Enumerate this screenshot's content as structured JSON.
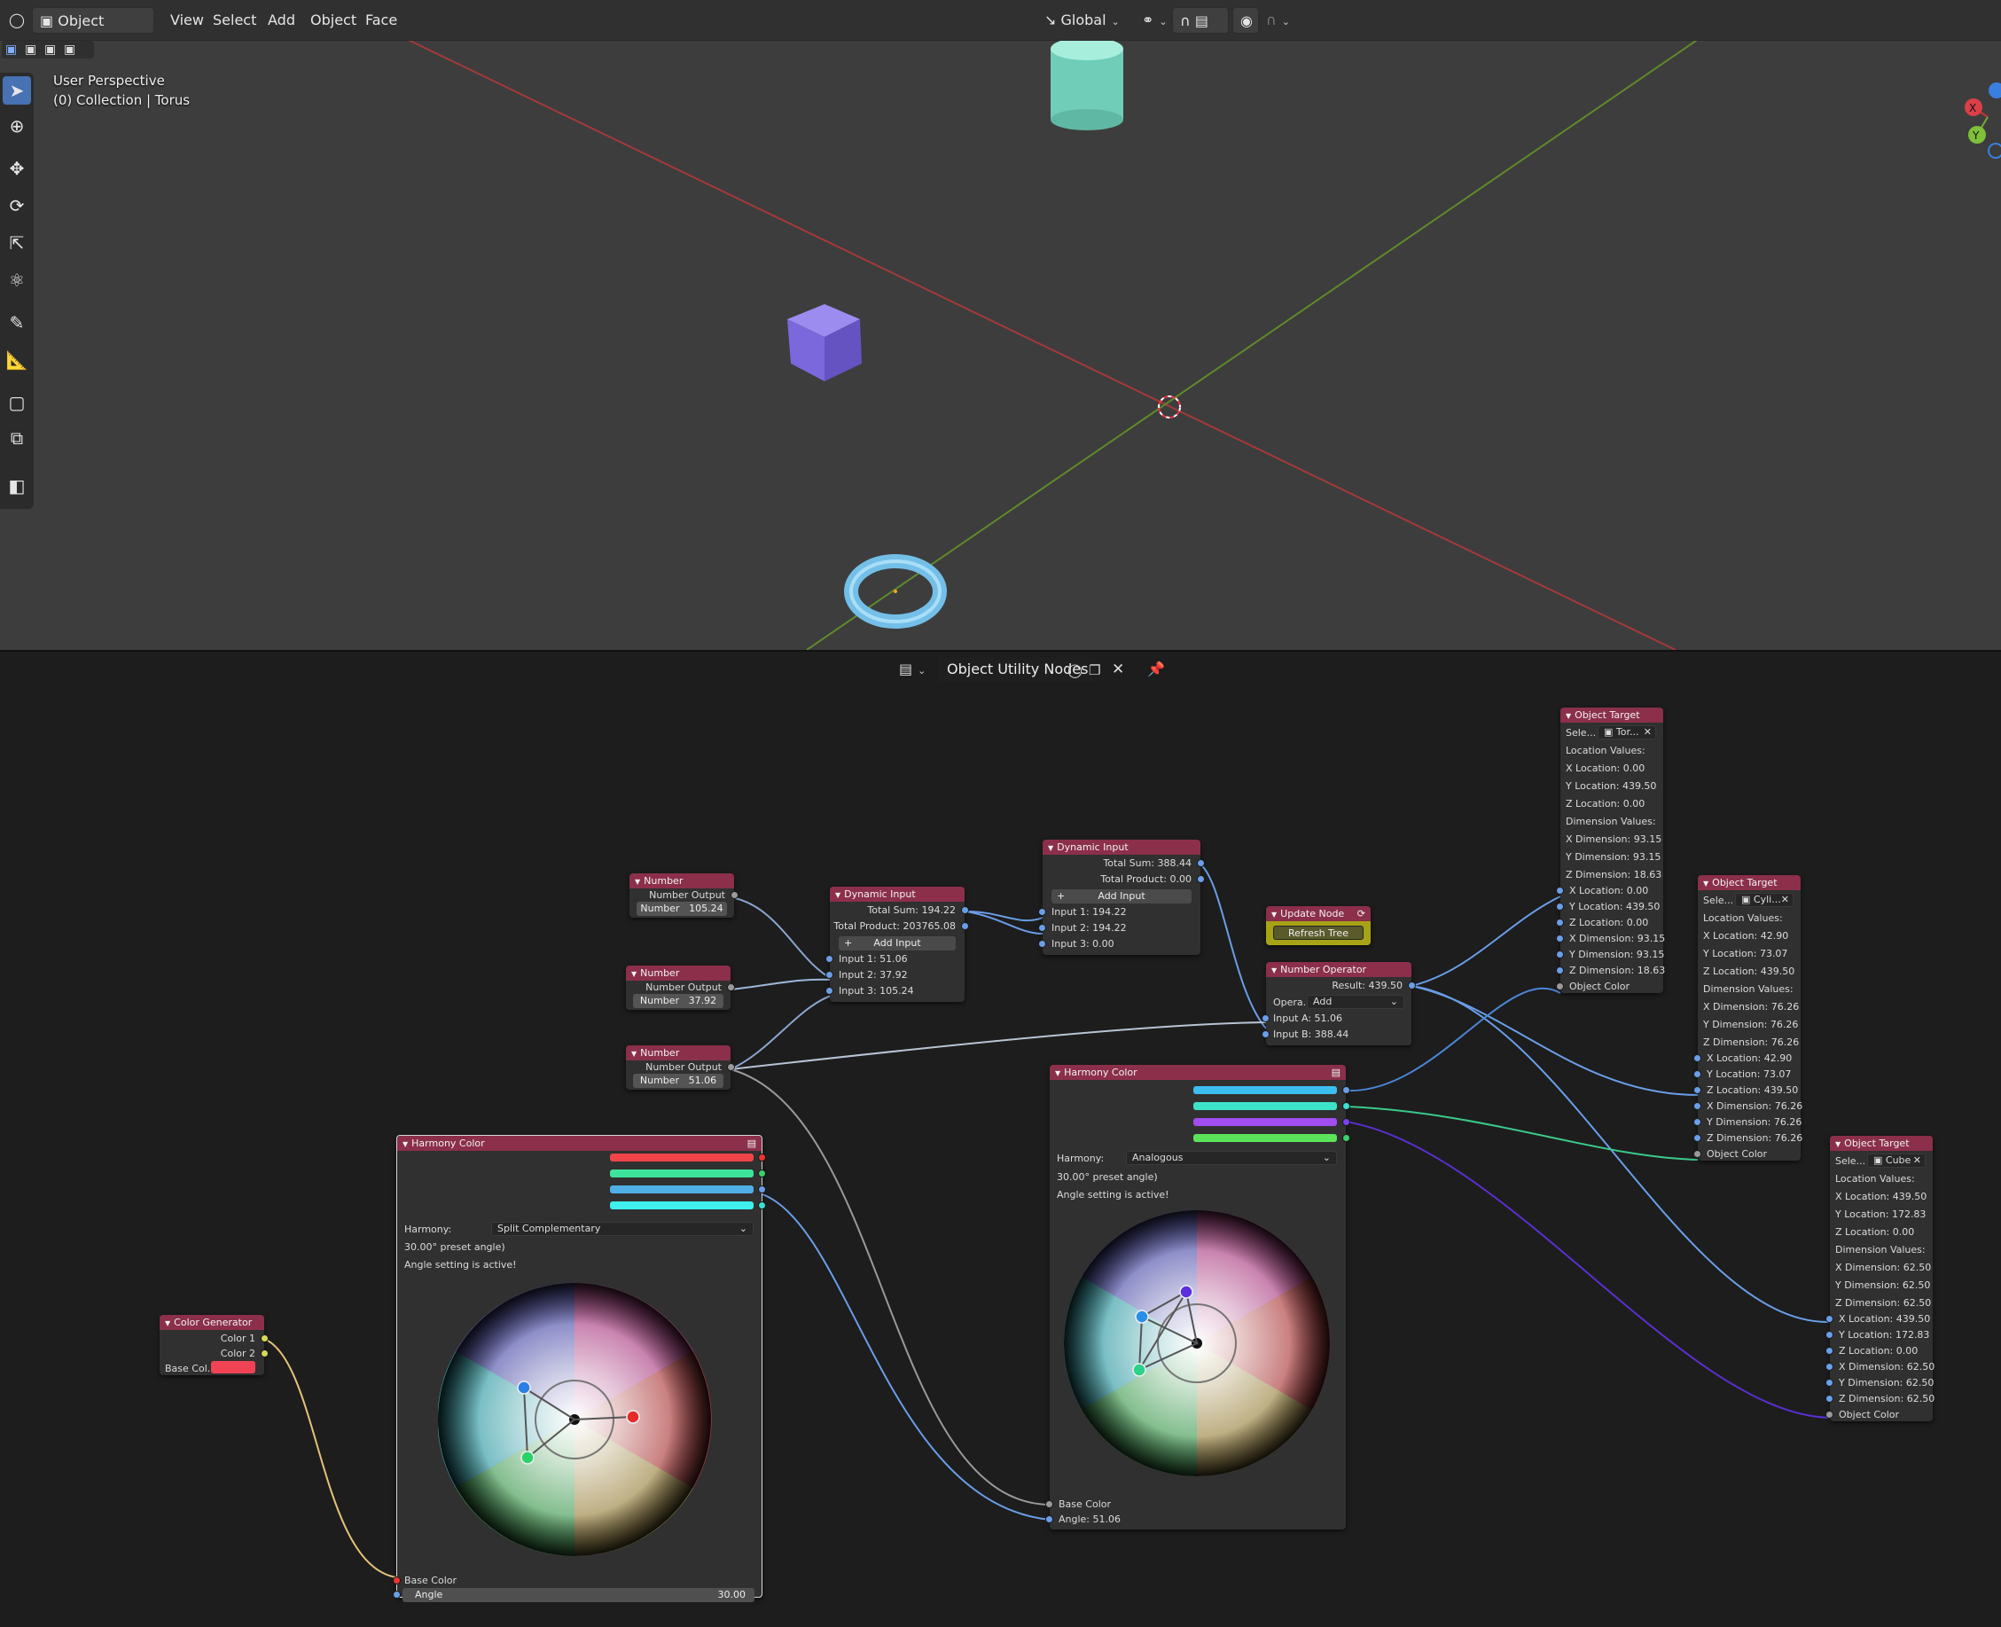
{
  "header": {
    "mode": "Object Mode",
    "menu": [
      "View",
      "Select",
      "Add",
      "Object",
      "Face"
    ],
    "orientation": "Global"
  },
  "viewport": {
    "perspective": "User Perspective",
    "collection": "(0) Collection | Torus",
    "colors": {
      "x_axis": "#a33a3a",
      "y_axis": "#5f8a2a",
      "cube": "#7a66d6",
      "cylinder": "#7fd6c4",
      "torus": "#6ab7e6"
    }
  },
  "node_editor": {
    "tree_name": "Object Utility Nodes"
  },
  "nodes": {
    "number1": {
      "title": "Number",
      "output": "Number Output",
      "label": "Number",
      "value": "105.24"
    },
    "number2": {
      "title": "Number",
      "output": "Number Output",
      "label": "Number",
      "value": "37.92"
    },
    "number3": {
      "title": "Number",
      "output": "Number Output",
      "label": "Number",
      "value": "51.06"
    },
    "dyn1": {
      "title": "Dynamic Input",
      "sum": "Total Sum: 194.22",
      "product": "Total Product: 203765.08",
      "add": "Add Input",
      "in1": "Input 1: 51.06",
      "in2": "Input 2: 37.92",
      "in3": "Input 3: 105.24"
    },
    "dyn2": {
      "title": "Dynamic Input",
      "sum": "Total Sum: 388.44",
      "product": "Total Product: 0.00",
      "add": "Add Input",
      "in1": "Input 1: 194.22",
      "in2": "Input 2: 194.22",
      "in3": "Input 3: 0.00"
    },
    "update": {
      "title": "Update Node",
      "button": "Refresh Tree"
    },
    "numop": {
      "title": "Number Operator",
      "result": "Result: 439.50",
      "op_label": "Opera...",
      "op_value": "Add",
      "a": "Input A: 51.06",
      "b": "Input B: 388.44"
    },
    "colorgen": {
      "title": "Color Generator",
      "c1": "Color 1",
      "c2": "Color 2",
      "base": "Base Col...",
      "base_color": "#f04455"
    },
    "harmony1": {
      "title": "Harmony Color",
      "harmony_label": "Harmony:",
      "harmony_value": "Split Complementary",
      "preset": "30.00° preset angle)",
      "active": "Angle setting is active!",
      "base": "Base Color",
      "angle_label": "Angle",
      "angle_value": "30.00",
      "swatches": [
        "#f04448",
        "#3de39a",
        "#4fb0e8",
        "#3ef0ee"
      ]
    },
    "harmony2": {
      "title": "Harmony Color",
      "harmony_label": "Harmony:",
      "harmony_value": "Analogous",
      "preset": "30.00° preset angle)",
      "active": "Angle setting is active!",
      "base": "Base Color",
      "angle": "Angle: 51.06",
      "swatches": [
        "#3dbef0",
        "#3de3c9",
        "#a24df0",
        "#5be35c"
      ]
    },
    "target1": {
      "title": "Object Target",
      "sel": "Sele...",
      "obj": "Tor...",
      "loc_head": "Location Values:",
      "xl": "X Location: 0.00",
      "yl": "Y Location: 439.50",
      "zl": "Z Location: 0.00",
      "dim_head": "Dimension Values:",
      "xd": "X Dimension: 93.15",
      "yd": "Y Dimension: 93.15",
      "zd": "Z Dimension: 18.63",
      "ixl": "X Location: 0.00",
      "iyl": "Y Location: 439.50",
      "izl": "Z Location: 0.00",
      "ixd": "X Dimension: 93.15",
      "iyd": "Y Dimension: 93.15",
      "izd": "Z Dimension: 18.63",
      "color": "Object Color"
    },
    "target2": {
      "title": "Object Target",
      "sel": "Sele...",
      "obj": "Cyli...",
      "loc_head": "Location Values:",
      "xl": "X Location: 42.90",
      "yl": "Y Location: 73.07",
      "zl": "Z Location: 439.50",
      "dim_head": "Dimension Values:",
      "xd": "X Dimension: 76.26",
      "yd": "Y Dimension: 76.26",
      "zd": "Z Dimension: 76.26",
      "ixl": "X Location: 42.90",
      "iyl": "Y Location: 73.07",
      "izl": "Z Location: 439.50",
      "ixd": "X Dimension: 76.26",
      "iyd": "Y Dimension: 76.26",
      "izd": "Z Dimension: 76.26",
      "color": "Object Color"
    },
    "target3": {
      "title": "Object Target",
      "sel": "Sele...",
      "obj": "Cube",
      "loc_head": "Location Values:",
      "xl": "X Location: 439.50",
      "yl": "Y Location: 172.83",
      "zl": "Z Location: 0.00",
      "dim_head": "Dimension Values:",
      "xd": "X Dimension: 62.50",
      "yd": "Y Dimension: 62.50",
      "zd": "Z Dimension: 62.50",
      "ixl": "X Location: 439.50",
      "iyl": "Y Location: 172.83",
      "izl": "Z Location: 0.00",
      "ixd": "X Dimension: 62.50",
      "iyd": "Y Dimension: 62.50",
      "izd": "Z Dimension: 62.50",
      "color": "Object Color"
    }
  }
}
